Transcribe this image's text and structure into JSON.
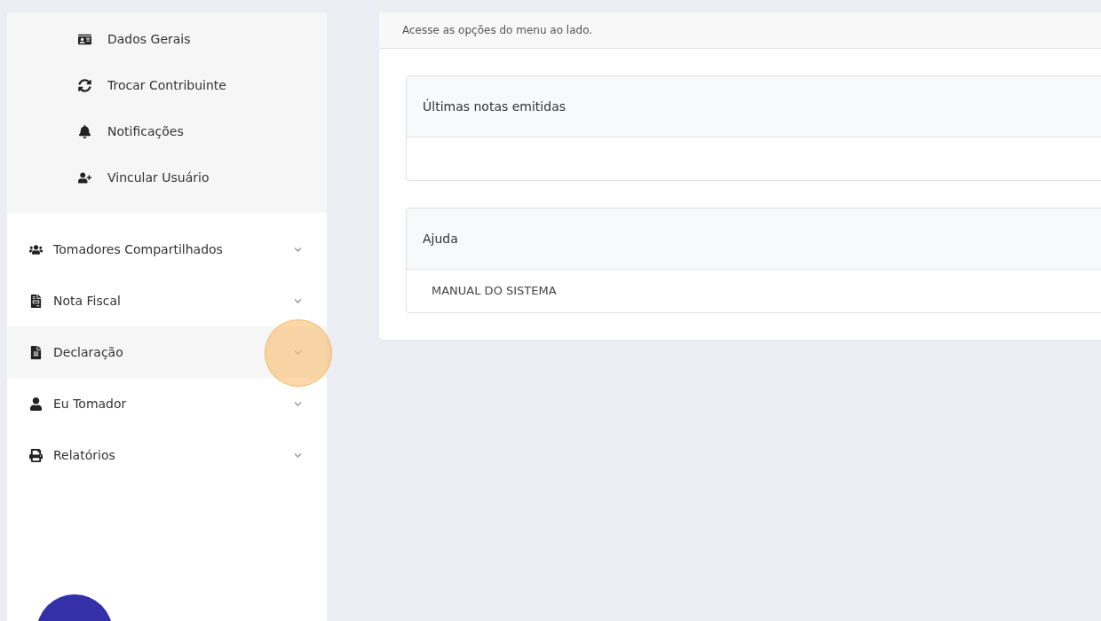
{
  "sidebar": {
    "submenu": [
      {
        "label": "Dados Gerais"
      },
      {
        "label": "Trocar Contribuinte"
      },
      {
        "label": "Notificações"
      },
      {
        "label": "Vincular Usuário"
      }
    ],
    "items": [
      {
        "label": "Tomadores Compartilhados",
        "selected": false,
        "expanded": false
      },
      {
        "label": "Nota Fiscal",
        "selected": false,
        "expanded": false
      },
      {
        "label": "Declaração",
        "selected": true,
        "expanded": false
      },
      {
        "label": "Eu Tomador",
        "selected": false,
        "expanded": false
      },
      {
        "label": "Relatórios",
        "selected": false,
        "expanded": false
      }
    ]
  },
  "main": {
    "intro": "Acesse as opções do menu ao lado.",
    "panels": [
      {
        "title": "Últimas notas emitidas"
      },
      {
        "title": "Ajuda",
        "links": [
          "MANUAL DO SISTEMA"
        ]
      }
    ]
  }
}
